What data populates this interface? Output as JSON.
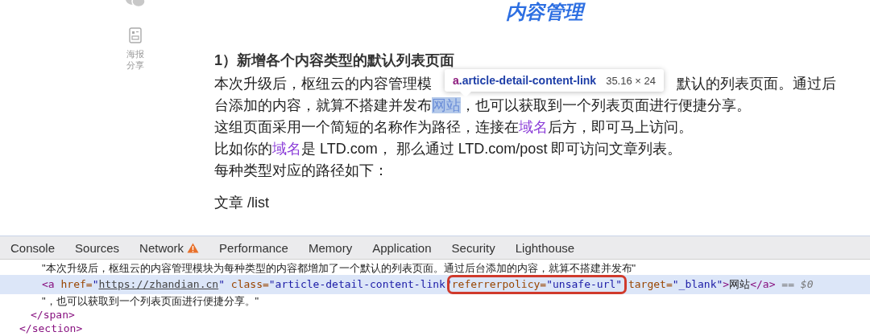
{
  "page_title": "内容管理",
  "sidebar": {
    "items": [
      {
        "kind": "chat"
      },
      {
        "kind": "poster",
        "label": "海报分享"
      }
    ]
  },
  "article": {
    "heading": "1）新增各个内容类型的默认列表页面",
    "lines": [
      {
        "segments": [
          {
            "kind": "text",
            "text": "本次升级后，枢纽云的内容管理模"
          },
          {
            "kind": "gap-text",
            "text": "默认的列表页面。通过后"
          }
        ]
      },
      {
        "segments": [
          {
            "kind": "text",
            "text": "台添加的内容，就算不搭建并发布"
          },
          {
            "kind": "highlighted-link",
            "text": "网站"
          },
          {
            "kind": "text",
            "text": "，也可以获取到一个列表页面进行便捷分享。"
          }
        ]
      },
      {
        "segments": [
          {
            "kind": "text",
            "text": "这组页面采用一个简短的名称作为路径，连接在"
          },
          {
            "kind": "link",
            "text": "域名"
          },
          {
            "kind": "text",
            "text": "后方，即可马上访问。"
          }
        ]
      },
      {
        "segments": [
          {
            "kind": "text",
            "text": "比如你的"
          },
          {
            "kind": "link",
            "text": "域名"
          },
          {
            "kind": "text",
            "text": "是 LTD.com， 那么通过 LTD.com/post 即可访问文章列表。"
          }
        ]
      },
      {
        "segments": [
          {
            "kind": "text",
            "text": "每种类型对应的路径如下："
          }
        ]
      }
    ],
    "path_line": "文章 /list",
    "tooltip": {
      "tag": "a",
      "class": ".article-detail-content-link",
      "size": "35.16 × 24"
    }
  },
  "devtools": {
    "tabs": [
      {
        "label": "Console",
        "warning": false
      },
      {
        "label": "Sources",
        "warning": false
      },
      {
        "label": "Network",
        "warning": true
      },
      {
        "label": "Performance",
        "warning": false
      },
      {
        "label": "Memory",
        "warning": false
      },
      {
        "label": "Application",
        "warning": false
      },
      {
        "label": "Security",
        "warning": false
      },
      {
        "label": "Lighthouse",
        "warning": false
      }
    ],
    "tree": {
      "close": "</section>",
      "children": [
        {
          "close": "</span>",
          "children": [
            {
              "selected": false,
              "tokens": [
                {
                  "kind": "text",
                  "text": "\"本次升级后，枢纽云的内容管理模块为每种类型的内容都增加了一个默认的列表页面。通过后台添加的内容，就算不搭建并发布\""
                }
              ]
            },
            {
              "selected": true,
              "tokens": [
                {
                  "kind": "tag",
                  "text": "<a"
                },
                {
                  "kind": "attr",
                  "text": " href="
                },
                {
                  "kind": "value",
                  "text": "\""
                },
                {
                  "kind": "url",
                  "text": "https://zhandian.cn"
                },
                {
                  "kind": "value",
                  "text": "\""
                },
                {
                  "kind": "attr",
                  "text": " class="
                },
                {
                  "kind": "value",
                  "text": "\"article-detail-content-link\""
                },
                {
                  "kind": "boxed",
                  "text": " referrerpolicy=",
                  "value": "\"unsafe-url\""
                },
                {
                  "kind": "attr",
                  "text": " target="
                },
                {
                  "kind": "value",
                  "text": "\"_blank\""
                },
                {
                  "kind": "tag",
                  "text": ">"
                },
                {
                  "kind": "text",
                  "text": "网站"
                },
                {
                  "kind": "tag",
                  "text": "</a>"
                },
                {
                  "kind": "marker",
                  "text": " == $0"
                }
              ]
            },
            {
              "selected": false,
              "tokens": [
                {
                  "kind": "text",
                  "text": "\"，也可以获取到一个列表页面进行便捷分享。\""
                }
              ]
            }
          ]
        }
      ]
    }
  }
}
